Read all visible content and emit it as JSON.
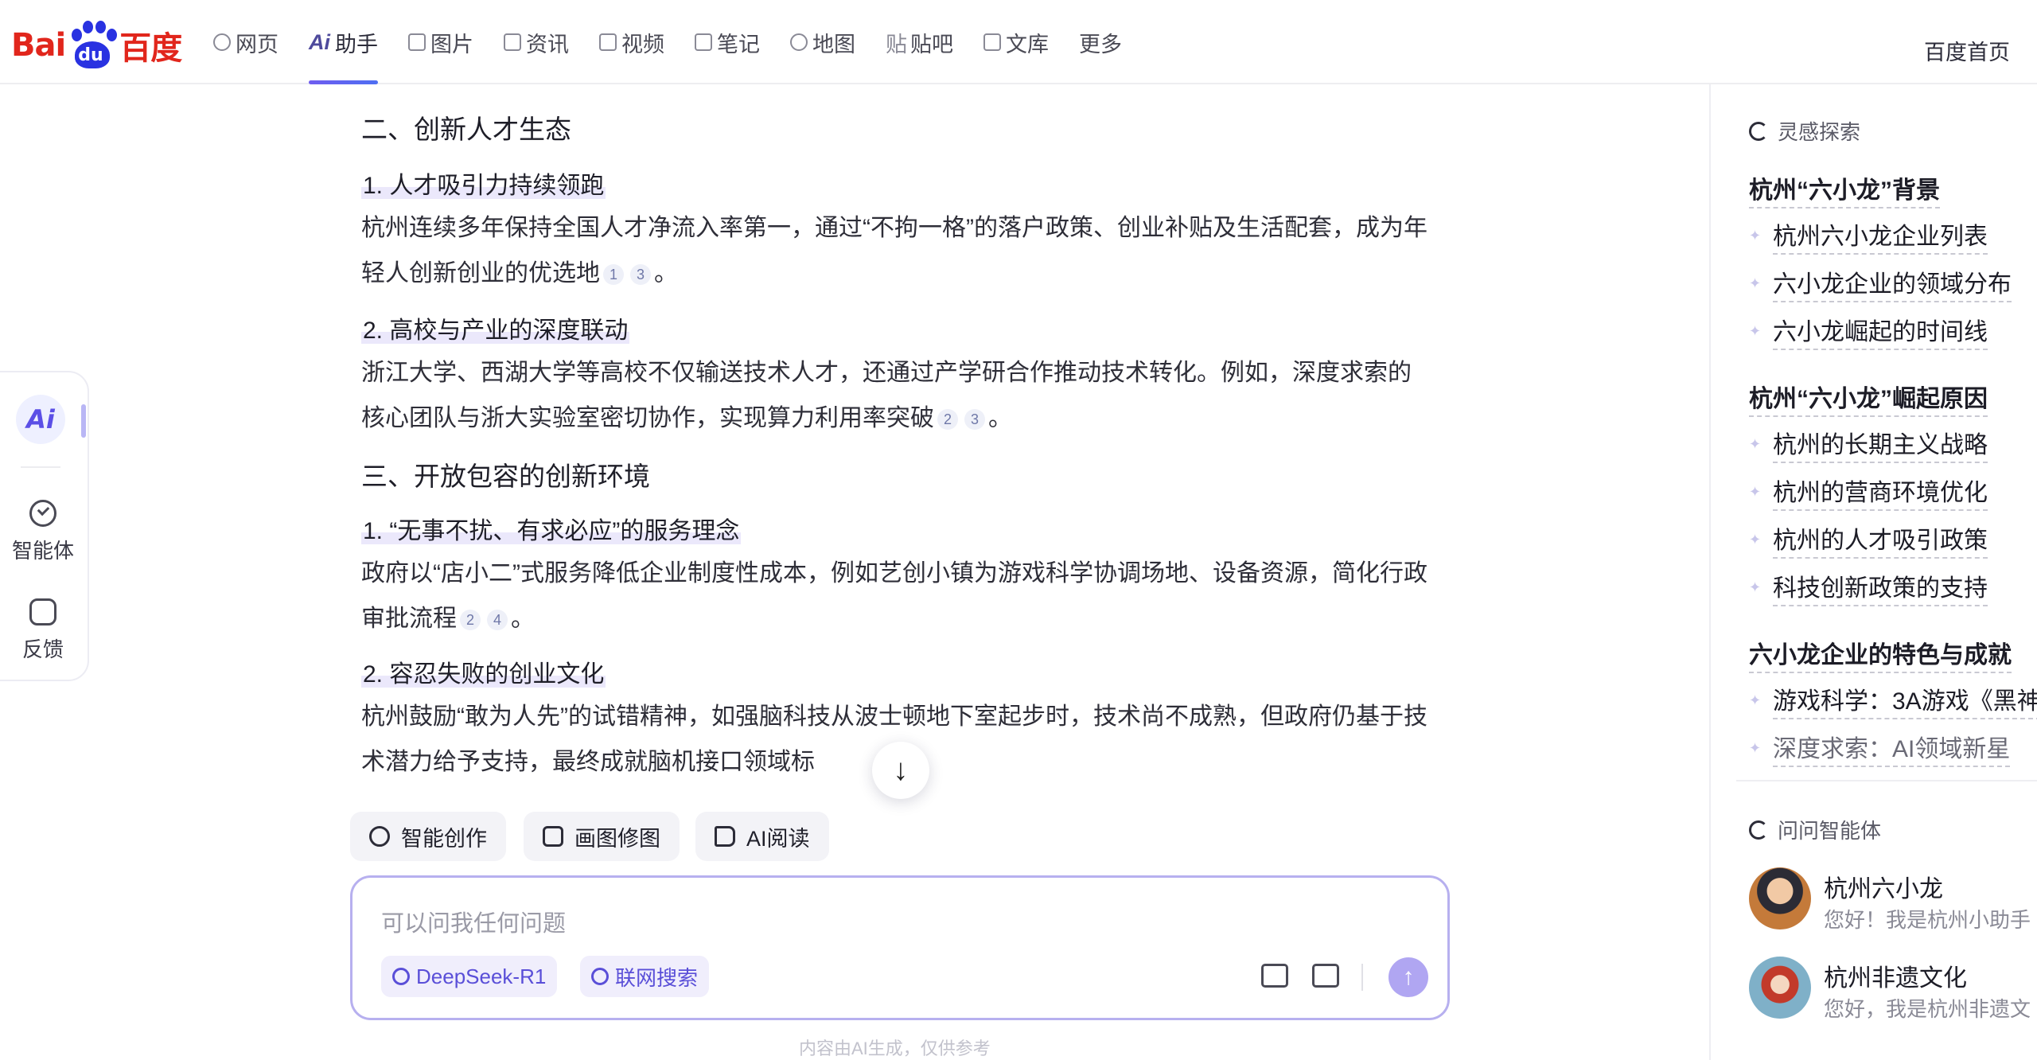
{
  "brand": {
    "logo_left": "Bai",
    "logo_paw": "du",
    "logo_right": "百度"
  },
  "nav": {
    "items": [
      {
        "label": "网页",
        "icon": "search-icon"
      },
      {
        "label": "助手",
        "icon": "ai-icon",
        "prefix": "Ai",
        "active": true
      },
      {
        "label": "图片",
        "icon": "image-icon"
      },
      {
        "label": "资讯",
        "icon": "news-icon"
      },
      {
        "label": "视频",
        "icon": "video-icon"
      },
      {
        "label": "笔记",
        "icon": "note-icon"
      },
      {
        "label": "地图",
        "icon": "map-icon"
      },
      {
        "label": "贴吧",
        "icon": "tieba-icon",
        "prefix": "贴"
      },
      {
        "label": "文库",
        "icon": "library-icon"
      },
      {
        "label": "更多"
      }
    ],
    "home_label": "百度首页"
  },
  "leftbar": {
    "ai_label": "Ai",
    "items": [
      {
        "label": "智能体",
        "icon": "agent-icon"
      },
      {
        "label": "反馈",
        "icon": "feedback-icon"
      }
    ]
  },
  "content": {
    "section2_title": "二、创新人才生态",
    "s2_item1_title": "1. 人才吸引力持续领跑",
    "s2_item1_text": "杭州连续多年保持全国人才净流入率第一，通过“不拘一格”的落户政策、创业补贴及生活配套，成为年轻人创新创业的优选地",
    "s2_item1_cites": [
      "1",
      "3"
    ],
    "s2_item2_title": "2. 高校与产业的深度联动",
    "s2_item2_text": "浙江大学、西湖大学等高校不仅输送技术人才，还通过产学研合作推动技术转化。例如，深度求索的核心团队与浙大实验室密切协作，实现算力利用率突破",
    "s2_item2_cites": [
      "2",
      "3"
    ],
    "section3_title": "三、开放包容的创新环境",
    "s3_item1_title": "1. “无事不扰、有求必应”的服务理念",
    "s3_item1_text": "政府以“店小二”式服务降低企业制度性成本，例如艺创小镇为游戏科学协调场地、设备资源，简化行政审批流程",
    "s3_item1_cites": [
      "2",
      "4"
    ],
    "s3_item2_title": "2. 容忍失败的创业文化",
    "s3_item2_text": "杭州鼓励“敢为人先”的试错精神，如强脑科技从波士顿地下室起步时，技术尚不成熟，但政府仍基于技术潜力给予支持，最终成就脑机接口领域标",
    "period": "。"
  },
  "tools": [
    {
      "label": "智能创作",
      "icon": "pen-icon"
    },
    {
      "label": "画图修图",
      "icon": "image-edit-icon"
    },
    {
      "label": "AI阅读",
      "icon": "book-icon"
    }
  ],
  "input": {
    "placeholder": "可以问我任何问题",
    "model_chip": "DeepSeek-R1",
    "search_chip": "联网搜索"
  },
  "disclaimer": "内容由AI生成，仅供参考",
  "sidebar": {
    "explore_title": "灵感探索",
    "groups": [
      {
        "title": "杭州“六小龙”背景",
        "items": [
          "杭州六小龙企业列表",
          "六小龙企业的领域分布",
          "六小龙崛起的时间线"
        ]
      },
      {
        "title": "杭州“六小龙”崛起原因",
        "items": [
          "杭州的长期主义战略",
          "杭州的营商环境优化",
          "杭州的人才吸引政策",
          "科技创新政策的支持"
        ]
      },
      {
        "title": "六小龙企业的特色与成就",
        "items": [
          "游戏科学：3A游戏《黑神",
          "深度求索：AI领域新星"
        ]
      }
    ],
    "agents_title": "问问智能体",
    "agents": [
      {
        "name": "杭州六小龙",
        "desc": "您好！我是杭州小助手"
      },
      {
        "name": "杭州非遗文化",
        "desc": "您好，我是杭州非遗文"
      }
    ]
  },
  "colors": {
    "accent": "#4e6ef2",
    "brand_red": "#e1261c",
    "brand_blue": "#2932e1",
    "chip_purple": "#5a4fd8"
  }
}
